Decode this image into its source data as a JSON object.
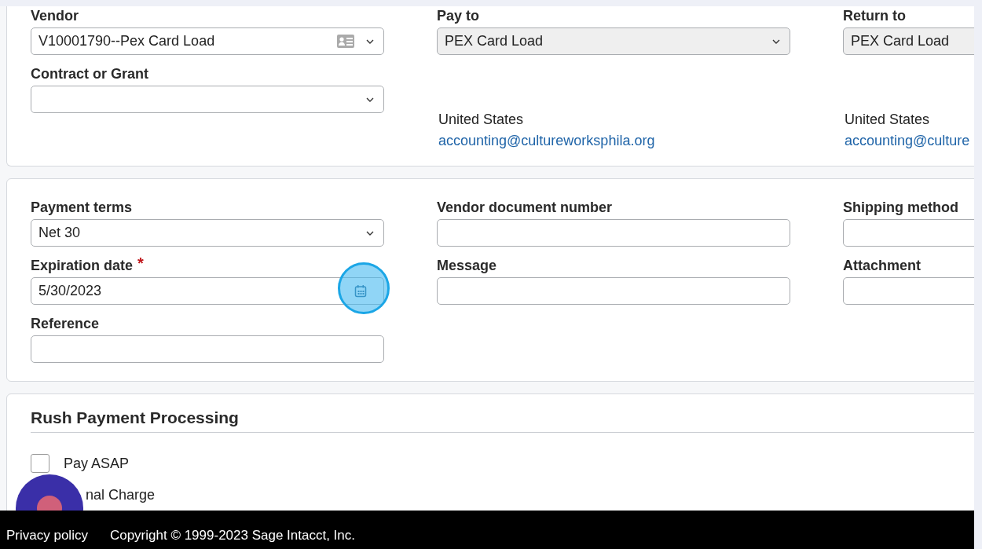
{
  "vendor_card": {
    "columns": [
      {
        "fields": [
          {
            "label": "Vendor",
            "kind": "select-card",
            "value": "V10001790--Pex Card Load",
            "disabled": false
          },
          {
            "label": "Contract or Grant",
            "kind": "select",
            "disabled": false
          }
        ]
      },
      {
        "fields": [
          {
            "label": "Pay to",
            "kind": "select",
            "value": "PEX Card Load",
            "disabled": true
          }
        ],
        "address": {
          "country": "United States",
          "email": "accounting@cultureworksphila.org"
        }
      },
      {
        "fields": [
          {
            "label": "Return to",
            "kind": "select-cut",
            "value": "PEX Card Load",
            "disabled": true
          }
        ],
        "address": {
          "country": "United States",
          "email": "accounting@culture"
        }
      }
    ]
  },
  "terms_card": {
    "columns": [
      {
        "fields": [
          {
            "label": "Payment terms",
            "kind": "select",
            "value": "Net 30",
            "disabled": false
          },
          {
            "label": "Expiration date",
            "required_mark": "*",
            "kind": "date",
            "value": "5/30/2023",
            "disabled": false
          },
          {
            "label": "Reference",
            "kind": "text",
            "disabled": false
          }
        ]
      },
      {
        "fields": [
          {
            "label": "Vendor document number",
            "kind": "text",
            "disabled": false
          },
          {
            "label": "Message",
            "kind": "text",
            "disabled": false
          }
        ]
      },
      {
        "fields": [
          {
            "label": "Shipping method",
            "kind": "text",
            "disabled": false
          },
          {
            "label": "Attachment",
            "kind": "text",
            "disabled": false
          }
        ]
      }
    ]
  },
  "rush_card": {
    "title": "Rush Payment Processing",
    "options": [
      {
        "label": "Pay ASAP",
        "checked": false
      },
      {
        "label": "nal Charge"
      }
    ]
  },
  "footer": {
    "links": [
      "Privacy policy"
    ],
    "copyright": "Copyright © 1999-2023 Sage Intacct, Inc."
  }
}
